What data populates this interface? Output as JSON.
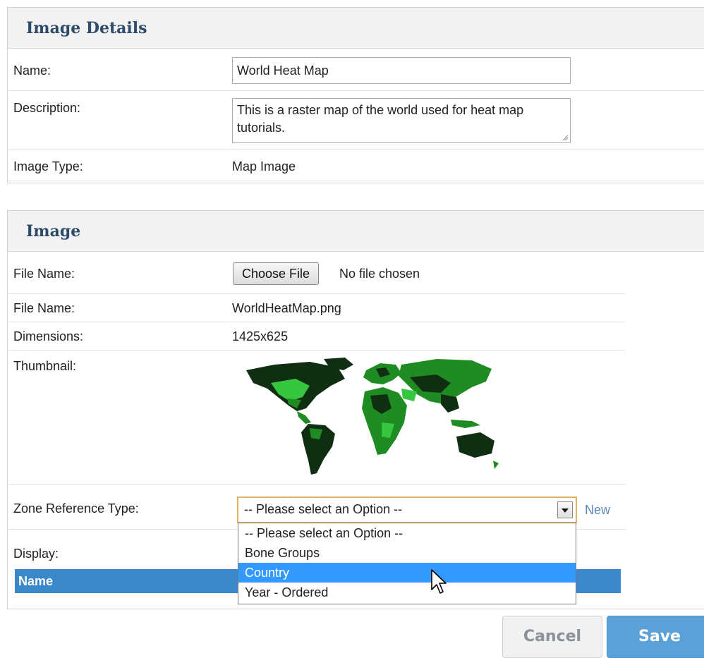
{
  "image_details": {
    "title": "Image Details",
    "name_label": "Name:",
    "name_value": "World Heat Map",
    "description_label": "Description:",
    "description_value": "This is a raster map of the world used for heat map tutorials.",
    "image_type_label": "Image Type:",
    "image_type_value": "Map Image"
  },
  "image": {
    "title": "Image",
    "file_input_label": "File Name:",
    "choose_file_label": "Choose File",
    "no_file_text": "No file chosen",
    "file_name_label": "File Name:",
    "file_name_value": "WorldHeatMap.png",
    "dimensions_label": "Dimensions:",
    "dimensions_value": "1425x625",
    "thumbnail_label": "Thumbnail:",
    "zone_ref_label": "Zone Reference Type:",
    "zone_ref_selected": "-- Please select an Option --",
    "zone_ref_options": [
      "-- Please select an Option --",
      "Bone Groups",
      "Country",
      "Year - Ordered"
    ],
    "zone_ref_highlighted": "Country",
    "new_link": "New",
    "display_label": "Display:",
    "table_header_name": "Name"
  },
  "buttons": {
    "cancel": "Cancel",
    "save": "Save"
  },
  "icons": {
    "select_arrow": "chevron-down-icon",
    "resize": "resize-grip-icon",
    "cursor": "mouse-pointer-icon",
    "thumbnail": "world-map-thumbnail"
  },
  "colors": {
    "header_text": "#2d4b6a",
    "highlight": "#3399ff",
    "table_header": "#3a87c9",
    "save_button": "#5ba0d6",
    "map_dark": "#0f2e12",
    "map_green": "#1e8c22",
    "map_light": "#37c640"
  }
}
